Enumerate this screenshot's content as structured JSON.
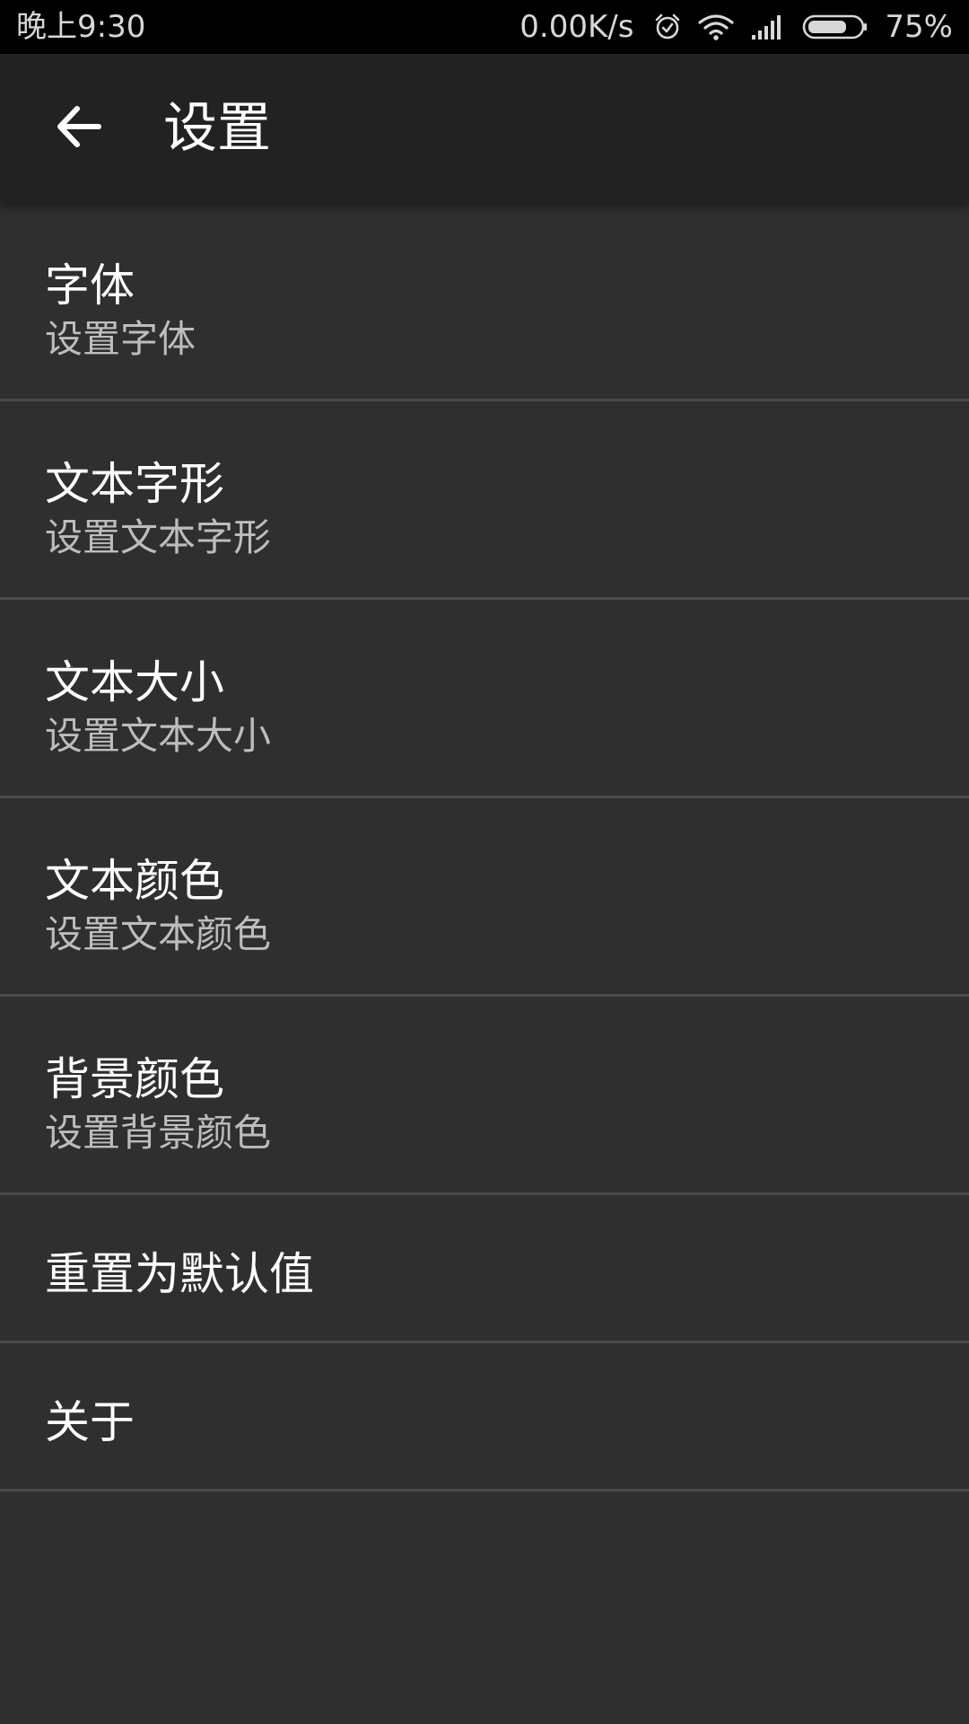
{
  "status_bar": {
    "time": "晚上9:30",
    "net_speed": "0.00K/s",
    "battery_percent": "75%",
    "battery_level": 0.75,
    "icons": [
      "alarm-icon",
      "wifi-icon",
      "signal-icon",
      "battery-icon"
    ]
  },
  "app_bar": {
    "back_icon": "arrow-back-icon",
    "title": "设置"
  },
  "settings": [
    {
      "title": "字体",
      "subtitle": "设置字体"
    },
    {
      "title": "文本字形",
      "subtitle": "设置文本字形"
    },
    {
      "title": "文本大小",
      "subtitle": "设置文本大小"
    },
    {
      "title": "文本颜色",
      "subtitle": "设置文本颜色"
    },
    {
      "title": "背景颜色",
      "subtitle": "设置背景颜色"
    },
    {
      "title": "重置为默认值"
    },
    {
      "title": "关于"
    }
  ],
  "colors": {
    "status_bar_bg": "#000000",
    "app_bar_bg": "#222222",
    "background": "#2f2f2f",
    "divider": "#4a4a4a",
    "title_text": "#ffffff",
    "subtitle_text": "#bdbdbd"
  }
}
